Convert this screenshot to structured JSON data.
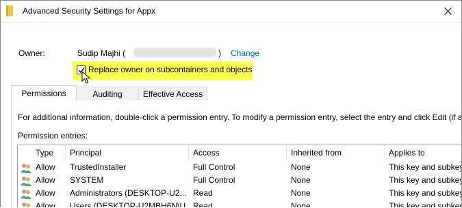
{
  "window": {
    "title": "Advanced Security Settings for Appx"
  },
  "owner": {
    "label": "Owner:",
    "name": "Sudip Majhi (",
    "paren_close": ")",
    "change_label": "Change",
    "replace_label": "Replace owner on subcontainers and objects",
    "replace_checked": true
  },
  "tabs": [
    {
      "label": "Permissions",
      "active": true
    },
    {
      "label": "Auditing",
      "active": false
    },
    {
      "label": "Effective Access",
      "active": false
    }
  ],
  "permissions": {
    "info": "For additional information, double-click a permission entry. To modify a permission entry, select the entry and click Edit (if a",
    "entries_label": "Permission entries:",
    "columns": [
      "Type",
      "Principal",
      "Access",
      "Inherited from",
      "Applies to"
    ],
    "rows": [
      {
        "type": "Allow",
        "principal": "TrustedInstaller",
        "access": "Full Control",
        "inherited": "None",
        "applies": "This key and subkeys"
      },
      {
        "type": "Allow",
        "principal": "SYSTEM",
        "access": "Full Control",
        "inherited": "None",
        "applies": "This key and subkeys"
      },
      {
        "type": "Allow",
        "principal": "Administrators (DESKTOP-U2...",
        "access": "Read",
        "inherited": "None",
        "applies": "This key and subkeys"
      },
      {
        "type": "Allow",
        "principal": "Users (DESKTOP-U2MBH6N\\U...",
        "access": "Read",
        "inherited": "None",
        "applies": "This key and subkeys"
      }
    ]
  },
  "icons": {
    "title": "folder-icon",
    "close": "close-icon",
    "principal": "users-icon",
    "cursor": "mouse-pointer-icon"
  },
  "colors": {
    "highlight": "#ffff54",
    "link": "#0066cc"
  }
}
